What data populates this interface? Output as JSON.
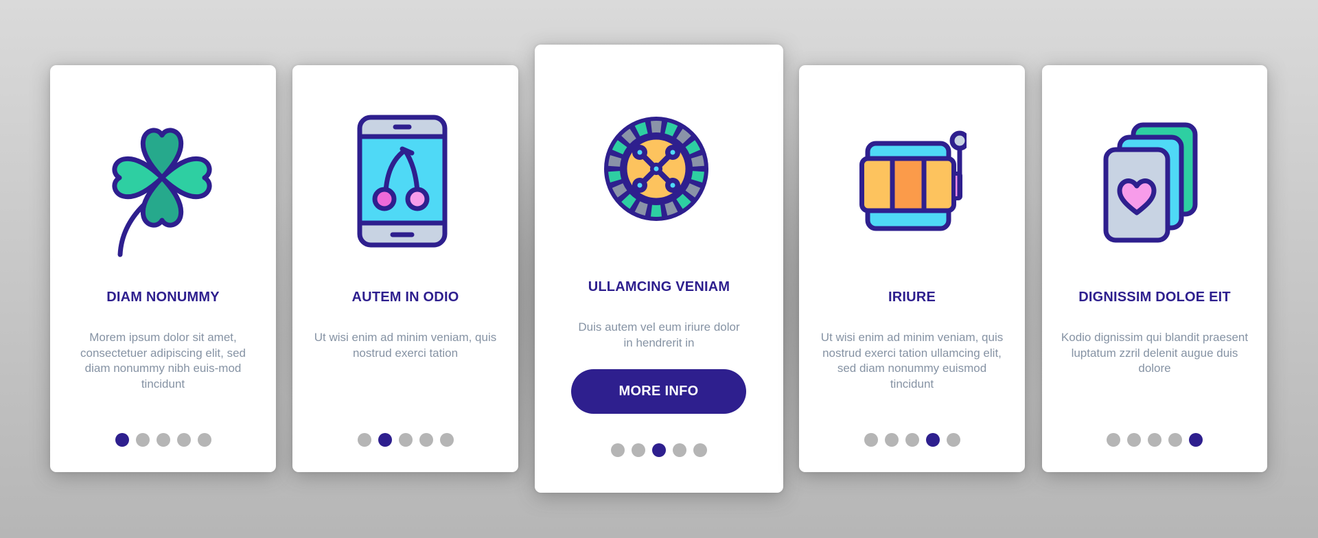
{
  "colors": {
    "accent": "#2e1f8e",
    "dot_inactive": "#b5b5b5",
    "description_text": "#8693a4",
    "card_background": "#ffffff"
  },
  "cards": [
    {
      "icon": "four-leaf-clover-icon",
      "title": "DIAM NONUMMY",
      "description": "Morem ipsum dolor sit amet, consectetuer adipiscing elit, sed diam nonummy nibh euis-mod tincidunt",
      "active_dot": 1
    },
    {
      "icon": "smartphone-cherry-icon",
      "title": "AUTEM IN ODIO",
      "description": "Ut wisi enim ad minim veniam, quis nostrud exerci tation",
      "active_dot": 2
    },
    {
      "icon": "roulette-wheel-icon",
      "title": "ULLAMCING VENIAM",
      "description": "Duis autem vel eum iriure dolor in hendrerit in",
      "button_label": "MORE INFO",
      "active_dot": 3
    },
    {
      "icon": "slot-machine-icon",
      "title": "IRIURE",
      "description": "Ut wisi enim ad minim veniam, quis nostrud exerci tation ullamcing elit, sed diam nonummy euismod tincidunt",
      "active_dot": 4
    },
    {
      "icon": "playing-cards-heart-icon",
      "title": "DIGNISSIM DOLOE EIT",
      "description": "Kodio dignissim qui blandit praesent luptatum zzril delenit augue duis dolore",
      "active_dot": 5
    }
  ],
  "pagination": {
    "total_pages": 5
  }
}
